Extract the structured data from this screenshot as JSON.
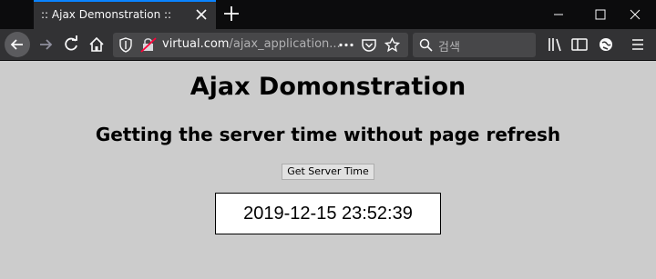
{
  "browser": {
    "tab_title": ":: Ajax Demonstration ::",
    "url_host": "virtual.com",
    "url_path": "/ajax_application...",
    "search_placeholder": "검색",
    "chrome_bg": "#0c0c0d",
    "toolbar_bg": "#323234",
    "accent": "#0a84ff"
  },
  "page": {
    "title": "Ajax Domonstration",
    "subtitle": "Getting the server time without page refresh",
    "button_label": "Get Server Time",
    "server_time": "2019-12-15 23:52:39",
    "background": "#cccccc"
  },
  "icons": {
    "back": "back-arrow-icon",
    "forward": "forward-arrow-icon",
    "reload": "reload-icon",
    "home": "home-icon",
    "shield": "shield-icon",
    "insecure": "insecure-lock-icon",
    "more": "more-actions-icon",
    "pocket": "pocket-icon",
    "bookmark": "bookmark-star-icon",
    "search": "search-icon",
    "library": "library-icon",
    "sidebar": "sidebar-icon",
    "extension": "extension-icon",
    "menu": "hamburger-menu-icon"
  }
}
